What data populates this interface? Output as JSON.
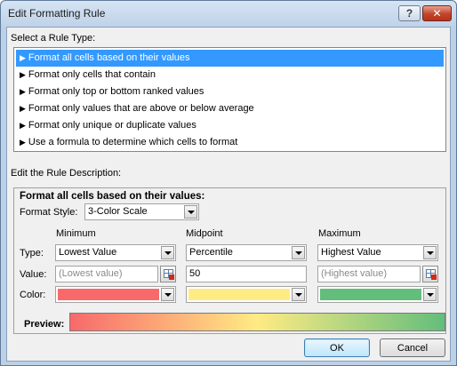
{
  "window": {
    "title": "Edit Formatting Rule",
    "help_label": "?",
    "close_label": "✕"
  },
  "rule_type": {
    "label": "Select a Rule Type:",
    "items": [
      "Format all cells based on their values",
      "Format only cells that contain",
      "Format only top or bottom ranked values",
      "Format only values that are above or below average",
      "Format only unique or duplicate values",
      "Use a formula to determine which cells to format"
    ],
    "selected_index": 0
  },
  "description": {
    "label": "Edit the Rule Description:",
    "heading": "Format all cells based on their values:",
    "format_style_label": "Format Style:",
    "format_style_value": "3-Color Scale",
    "row_labels": {
      "type": "Type:",
      "value": "Value:",
      "color": "Color:"
    },
    "minimum": {
      "header": "Minimum",
      "type": "Lowest Value",
      "value": "(Lowest value)",
      "color": "#f8696b"
    },
    "midpoint": {
      "header": "Midpoint",
      "type": "Percentile",
      "value": "50",
      "color": "#ffeb84"
    },
    "maximum": {
      "header": "Maximum",
      "type": "Highest Value",
      "value": "(Highest value)",
      "color": "#63be7b"
    },
    "preview_label": "Preview:"
  },
  "buttons": {
    "ok": "OK",
    "cancel": "Cancel"
  }
}
